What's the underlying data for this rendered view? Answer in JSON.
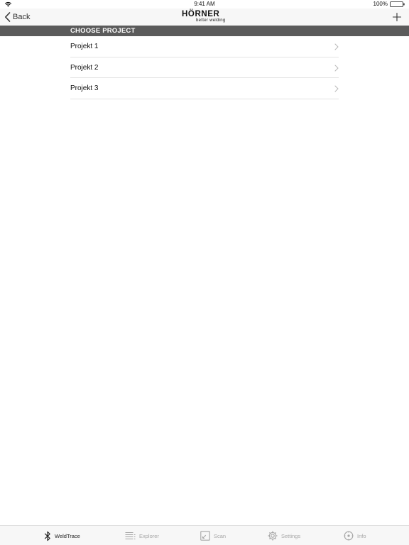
{
  "status_bar": {
    "time": "9:41 AM",
    "battery": "100%"
  },
  "nav": {
    "back_label": "Back",
    "brand_name": "HÖRNER",
    "brand_tagline": "better welding",
    "add_icon": "plus-icon"
  },
  "section": {
    "title": "CHOOSE PROJECT"
  },
  "projects": [
    {
      "label": "Projekt 1"
    },
    {
      "label": "Projekt 2"
    },
    {
      "label": "Projekt 3"
    }
  ],
  "tabs": [
    {
      "label": "WeldTrace",
      "icon": "bluetooth-icon",
      "active": true
    },
    {
      "label": "Explorer",
      "icon": "list-icon",
      "active": false
    },
    {
      "label": "Scan",
      "icon": "scan-icon",
      "active": false
    },
    {
      "label": "Settings",
      "icon": "gear-icon",
      "active": false
    },
    {
      "label": "Info",
      "icon": "info-icon",
      "active": false
    }
  ],
  "colors": {
    "section_header_bg": "#5b5b5b",
    "tab_active": "#222222",
    "tab_inactive": "#a6a6a6"
  }
}
